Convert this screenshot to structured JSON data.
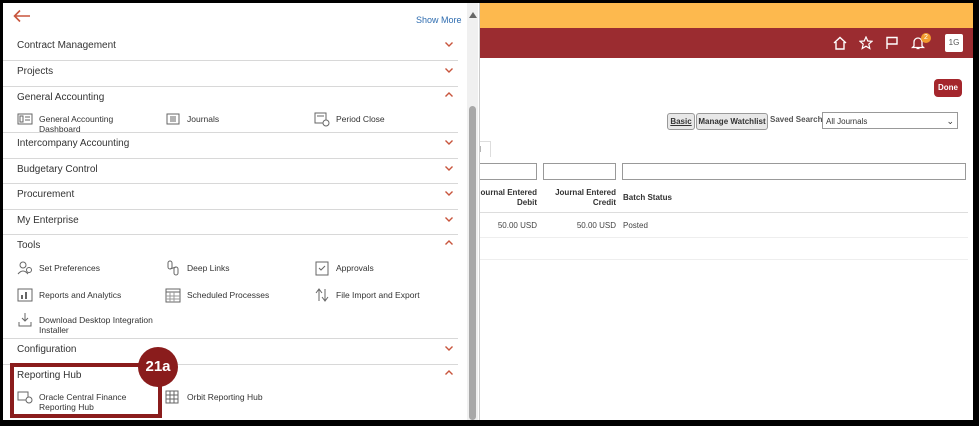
{
  "header": {
    "icons": [
      "home-icon",
      "star-icon",
      "flag-icon",
      "bell-icon"
    ],
    "notification_count": "2",
    "avatar_initials": "1G"
  },
  "page": {
    "done_label": "Done",
    "basic_label": "Basic",
    "manage_watchlist_label": "Manage Watchlist",
    "saved_search_label": "Saved Search",
    "saved_search_value": "All Journals",
    "tab_fragment": "al",
    "columns": [
      "Journal Entered Debit",
      "Journal Entered Credit",
      "Batch Status"
    ],
    "col_debit_line1": "ournal Entered",
    "col_debit_line2": "Debit",
    "col_credit_line1": "Journal Entered",
    "col_credit_line2": "Credit",
    "col_status": "Batch Status",
    "row": {
      "debit": "50.00 USD",
      "credit": "50.00 USD",
      "status": "Posted"
    }
  },
  "navigator": {
    "show_more": "Show More",
    "sections": {
      "contract_management": "Contract Management",
      "projects": "Projects",
      "general_accounting": "General Accounting",
      "intercompany_accounting": "Intercompany Accounting",
      "budgetary_control": "Budgetary Control",
      "procurement": "Procurement",
      "my_enterprise": "My Enterprise",
      "tools": "Tools",
      "configuration": "Configuration",
      "reporting_hub": "Reporting Hub"
    },
    "general_accounting_items": {
      "dashboard": "General Accounting Dashboard",
      "journals": "Journals",
      "period_close": "Period Close"
    },
    "tools_items": {
      "set_preferences": "Set Preferences",
      "deep_links": "Deep Links",
      "approvals": "Approvals",
      "reports_analytics": "Reports and Analytics",
      "scheduled_processes": "Scheduled Processes",
      "file_import_export": "File Import and Export",
      "download_desktop": "Download Desktop Integration Installer"
    },
    "reporting_hub_items": {
      "oracle_cf": "Oracle Central Finance Reporting Hub",
      "orbit": "Orbit Reporting Hub"
    }
  },
  "annotation": {
    "step_label": "21a"
  },
  "colors": {
    "header_red": "#9b2c30",
    "header_yellow": "#fdb94e",
    "accent": "#c8553d",
    "callout": "#8a1c1c"
  }
}
